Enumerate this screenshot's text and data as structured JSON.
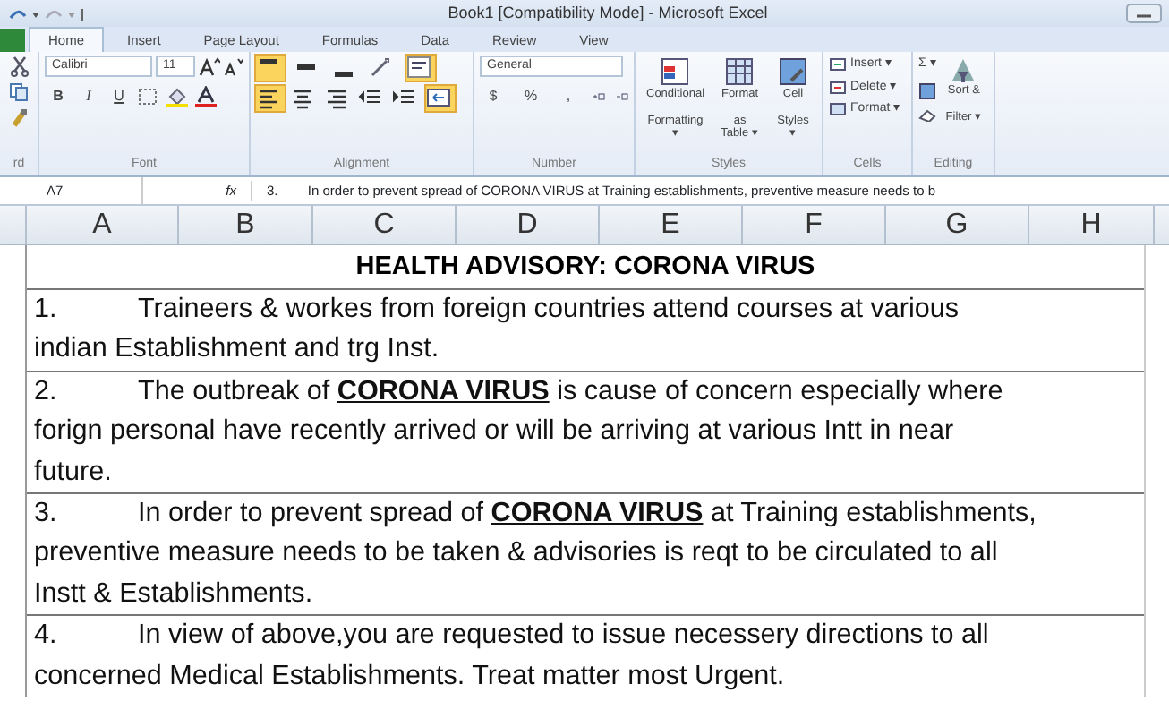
{
  "window": {
    "title": "Book1  [Compatibility Mode]  -  Microsoft Excel"
  },
  "tabs": [
    {
      "label": "Home",
      "selected": true
    },
    {
      "label": "Insert",
      "selected": false
    },
    {
      "label": "Page Layout",
      "selected": false
    },
    {
      "label": "Formulas",
      "selected": false
    },
    {
      "label": "Data",
      "selected": false
    },
    {
      "label": "Review",
      "selected": false
    },
    {
      "label": "View",
      "selected": false
    }
  ],
  "ribbon": {
    "clipboard": {
      "label": "rd"
    },
    "font": {
      "label": "Font",
      "font_name": "Calibri",
      "font_size": "11",
      "bold": "B",
      "italic": "I",
      "underline": "U"
    },
    "alignment": {
      "label": "Alignment",
      "buttons": [
        {
          "kind": "top",
          "pressed": true
        },
        {
          "kind": "middle",
          "pressed": false
        },
        {
          "kind": "bottom",
          "pressed": false
        },
        {
          "kind": "orient",
          "pressed": false
        },
        {
          "kind": "wrap",
          "pressed": true
        },
        {
          "kind": "left",
          "pressed": true
        },
        {
          "kind": "center",
          "pressed": false
        },
        {
          "kind": "right",
          "pressed": false
        },
        {
          "kind": "outdent",
          "pressed": false
        },
        {
          "kind": "indent",
          "pressed": false
        },
        {
          "kind": "merge",
          "pressed": true
        }
      ]
    },
    "number": {
      "label": "Number",
      "format": "General",
      "symbols": [
        "$",
        "%",
        ","
      ]
    },
    "styles": {
      "label": "Styles",
      "buttons": [
        {
          "line1": "Conditional",
          "line2": "Formatting ▾"
        },
        {
          "line1": "Format",
          "line2": "as Table ▾"
        },
        {
          "line1": "Cell",
          "line2": "Styles ▾"
        }
      ]
    },
    "cells": {
      "label": "Cells",
      "buttons": [
        "Insert ▾",
        "Delete ▾",
        "Format ▾"
      ]
    },
    "editing": {
      "label": "Editing",
      "sum": "Σ ▾",
      "sort_line1": "Sort &",
      "sort_line2": "Filter ▾"
    }
  },
  "formula_bar": {
    "name_box": "A7",
    "fx": "fx",
    "formula": "3.        In order to prevent spread of CORONA VIRUS at Training establishments, preventive measure needs to b"
  },
  "columns": [
    "A",
    "B",
    "C",
    "D",
    "E",
    "F",
    "G",
    "H"
  ],
  "heading": "HEALTH ADVISORY: CORONA VIRUS",
  "paragraphs": [
    {
      "number": "1.",
      "lines": [
        "Traineers & workes  from foreign countries attend courses at various",
        "indian Establishment and trg Inst."
      ]
    },
    {
      "number": "2.",
      "lines": [
        "The outbreak of **CORONA VIRUS** is cause of concern especially where",
        "forign personal have recently arrived or will be arriving at various Intt in near",
        "future."
      ]
    },
    {
      "number": "3.",
      "lines": [
        "In order to prevent spread of **CORONA VIRUS** at Training establishments,",
        "preventive measure needs to be taken & advisories is reqt to be circulated to all",
        "Instt & Establishments."
      ]
    },
    {
      "number": "4.",
      "lines": [
        "In view of above,you are requested to issue necessery directions to all",
        "concerned Medical Establishments. Treat matter most Urgent."
      ]
    }
  ]
}
